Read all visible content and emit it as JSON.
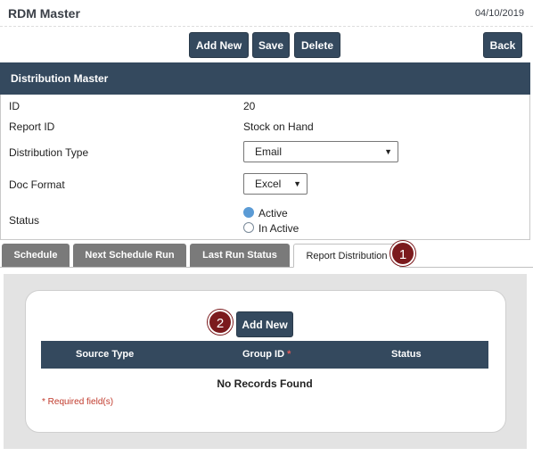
{
  "header": {
    "title": "RDM Master",
    "date": "04/10/2019"
  },
  "toolbar": {
    "add_new": "Add New",
    "save": "Save",
    "delete": "Delete",
    "back": "Back"
  },
  "section": {
    "title": "Distribution Master"
  },
  "form": {
    "id_label": "ID",
    "id_value": "20",
    "report_id_label": "Report ID",
    "report_id_value": "Stock on Hand",
    "dist_type_label": "Distribution Type",
    "dist_type_value": "Email",
    "doc_format_label": "Doc Format",
    "doc_format_value": "Excel",
    "status_label": "Status",
    "status_active": "Active",
    "status_inactive": "In Active",
    "status_selected": "Active"
  },
  "tabs": [
    {
      "label": "Schedule"
    },
    {
      "label": "Next Schedule Run"
    },
    {
      "label": "Last Run Status"
    },
    {
      "label": "Report Distribution"
    }
  ],
  "callouts": {
    "one": "1",
    "two": "2"
  },
  "subpanel": {
    "add_new": "Add New",
    "columns": [
      "Source Type",
      "Group ID",
      "Status"
    ],
    "required_marker": "*",
    "empty_text": "No Records Found",
    "required_note": "* Required field(s)"
  },
  "colors": {
    "primary": "#34495e",
    "tab_inactive": "#7a7a7a",
    "callout": "#7b1a1d",
    "radio_on": "#5b9bd5",
    "required": "#c0392b"
  }
}
